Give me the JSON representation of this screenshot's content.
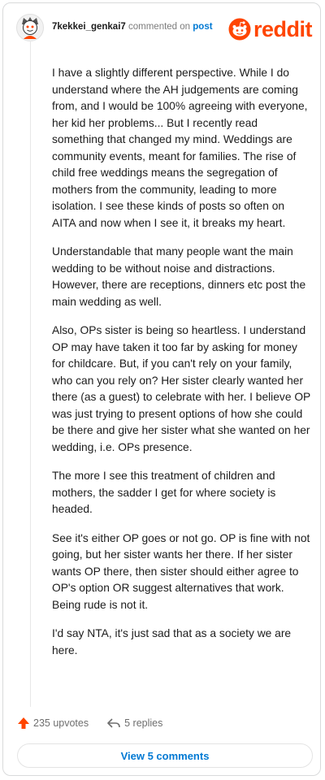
{
  "comment": {
    "username": "7kekkei_genkai7",
    "commented_on": "commented on",
    "post_link": "post",
    "logo_text": "reddit",
    "paragraphs": [
      "I have a slightly different perspective. While I do understand where the AH judgements are coming from, and I would be 100% agreeing with everyone, her kid her problems... But I recently read something that changed my mind. Weddings are community events, meant for families. The rise of child free weddings means the segregation of mothers from the community, leading to more isolation. I see these kinds of posts so often on AITA and now when I see it, it breaks my heart.",
      "Understandable that many people want the main wedding to be without noise and distractions. However, there are receptions, dinners etc post the main wedding as well.",
      "Also, OPs sister is being so heartless. I understand OP may have taken it too far by asking for money for childcare. But, if you can't rely on your family, who can you rely on? Her sister clearly wanted her there (as a guest) to celebrate with her. I believe OP was just trying to present options of how she could be there and give her sister what she wanted on her wedding, i.e. OPs presence.",
      "The more I see this treatment of children and mothers, the sadder I get for where society is headed.",
      "See it's either OP goes or not go. OP is fine with not going, but her sister wants her there. If her sister wants OP there, then sister should either agree to OP's option OR suggest alternatives that work. Being rude is not it.",
      "I'd say NTA, it's just sad that as a society we are here."
    ],
    "upvotes": "235 upvotes",
    "replies": "5 replies",
    "view_comments": "View 5 comments"
  },
  "icons": {
    "avatar": "snoo-avatar-icon",
    "logo": "reddit-snoo-icon",
    "upvote": "upvote-arrow-icon",
    "reply": "reply-arrow-icon"
  },
  "colors": {
    "brand": "#ff4500",
    "link": "#0079d3",
    "muted": "#7c7c7c",
    "text": "#1c1c1c"
  }
}
